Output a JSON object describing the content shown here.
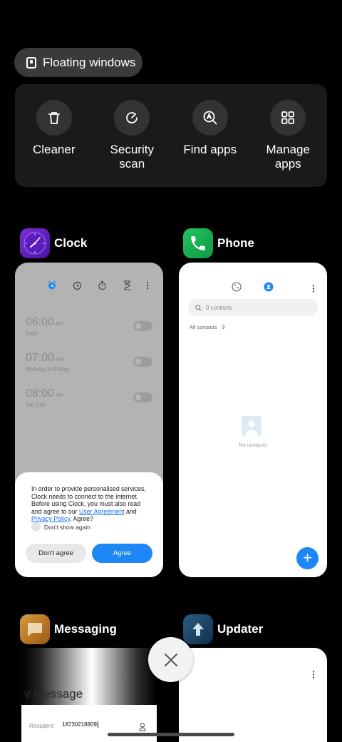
{
  "floating_windows": {
    "label": "Floating windows"
  },
  "tools": [
    {
      "label": "Cleaner",
      "icon": "trash-icon"
    },
    {
      "label": "Security scan",
      "icon": "security-scan-icon"
    },
    {
      "label": "Find apps",
      "icon": "find-apps-icon"
    },
    {
      "label": "Manage apps",
      "icon": "grid-icon"
    }
  ],
  "apps": {
    "clock": {
      "name": "Clock",
      "alarms": [
        {
          "time": "06:00",
          "ampm": "am",
          "repeat": "Daily"
        },
        {
          "time": "07:00",
          "ampm": "am",
          "repeat": "Monday to Friday"
        },
        {
          "time": "08:00",
          "ampm": "am",
          "repeat": "Sat Sun"
        }
      ],
      "dialog": {
        "text_1": "In order to provide personalised services, Clock needs to connect to the internet. Before using Clock, you must also read and agree to our ",
        "link_1": "User Agreement",
        "text_2": " and ",
        "link_2": "Privacy Policy",
        "text_3": ". Agree?",
        "checkbox_label": "Don't show again",
        "disagree_label": "Don't agree",
        "agree_label": "Agree"
      }
    },
    "phone": {
      "name": "Phone",
      "search_placeholder": "0 contacts",
      "filter_label": "All contacts",
      "empty_text": "No contacts",
      "fab_label": "+"
    },
    "messaging": {
      "name": "Messaging",
      "title_partial": "v message",
      "recipient_label": "Recipient:",
      "recipient_value": "18730218809"
    },
    "updater": {
      "name": "Updater"
    }
  },
  "colors": {
    "accent": "#1f87f5",
    "background": "#000000",
    "panel": "#1a1a1a"
  }
}
